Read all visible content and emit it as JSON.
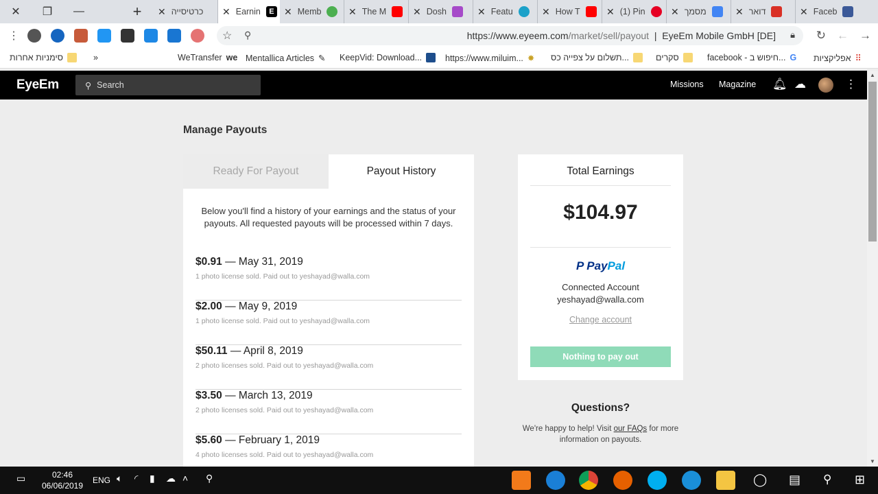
{
  "browser": {
    "tabs": [
      {
        "label": "כרטיסייה"
      },
      {
        "label": "Earnin",
        "active": true
      },
      {
        "label": "Memb"
      },
      {
        "label": "The M"
      },
      {
        "label": "Dosh"
      },
      {
        "label": "Featu"
      },
      {
        "label": "How T"
      },
      {
        "label": "(1) Pin"
      },
      {
        "label": "מסמך"
      },
      {
        "label": "דואר"
      },
      {
        "label": "Faceb"
      }
    ],
    "url_main": "https://www.eyeem.com",
    "url_path": "/market/sell/payout",
    "site_identity": "EyeEm Mobile GmbH [DE]",
    "bookmarks": [
      {
        "label": "סימניות אחרות"
      },
      {
        "label": "»"
      },
      {
        "label": "WeTransfer"
      },
      {
        "label": "Mentallica Articles"
      },
      {
        "label": "KeepVid: Download..."
      },
      {
        "label": "https://www.miluim..."
      },
      {
        "label": "תשלום על צפייה כס..."
      },
      {
        "label": "סקרים"
      },
      {
        "label": "facebook - חיפוש ב..."
      },
      {
        "label": "אפליקציות"
      }
    ]
  },
  "site": {
    "logo": "EyeEm",
    "search_placeholder": "Search",
    "nav": {
      "missions": "Missions",
      "magazine": "Magazine"
    }
  },
  "page": {
    "title": "Manage Payouts",
    "tabs": {
      "ready": "Ready For Payout",
      "history": "Payout History"
    },
    "intro": "Below you'll find a history of your earnings and the status of your payouts. All requested payouts will be processed within 7 days.",
    "payouts": [
      {
        "amount": "$0.91",
        "date": "May 31, 2019",
        "detail": "1 photo license sold. Paid out to yeshayad@walla.com"
      },
      {
        "amount": "$2.00",
        "date": "May 9, 2019",
        "detail": "1 photo license sold. Paid out to yeshayad@walla.com"
      },
      {
        "amount": "$50.11",
        "date": "April 8, 2019",
        "detail": "2 photo licenses sold. Paid out to yeshayad@walla.com"
      },
      {
        "amount": "$3.50",
        "date": "March 13, 2019",
        "detail": "2 photo licenses sold. Paid out to yeshayad@walla.com"
      },
      {
        "amount": "$5.60",
        "date": "February 1, 2019",
        "detail": "4 photo licenses sold. Paid out to yeshayad@walla.com"
      }
    ],
    "earnings": {
      "title": "Total Earnings",
      "amount": "$104.97",
      "paypal_a": "Pay",
      "paypal_b": "Pal",
      "connected_label": "Connected Account",
      "connected_email": "yeshayad@walla.com",
      "change_account": "Change account",
      "pay_button": "Nothing to pay out"
    },
    "questions": {
      "title": "Questions?",
      "text_before": "We're happy to help! Visit ",
      "link": "our FAQs",
      "text_after": " for more information on payouts."
    }
  },
  "taskbar": {
    "language": "ENG",
    "time": "02:46",
    "date": "06/06/2019"
  },
  "colors": {
    "pay_button": "#8fdbb8",
    "paypal_dark": "#003087",
    "paypal_light": "#009cde"
  }
}
